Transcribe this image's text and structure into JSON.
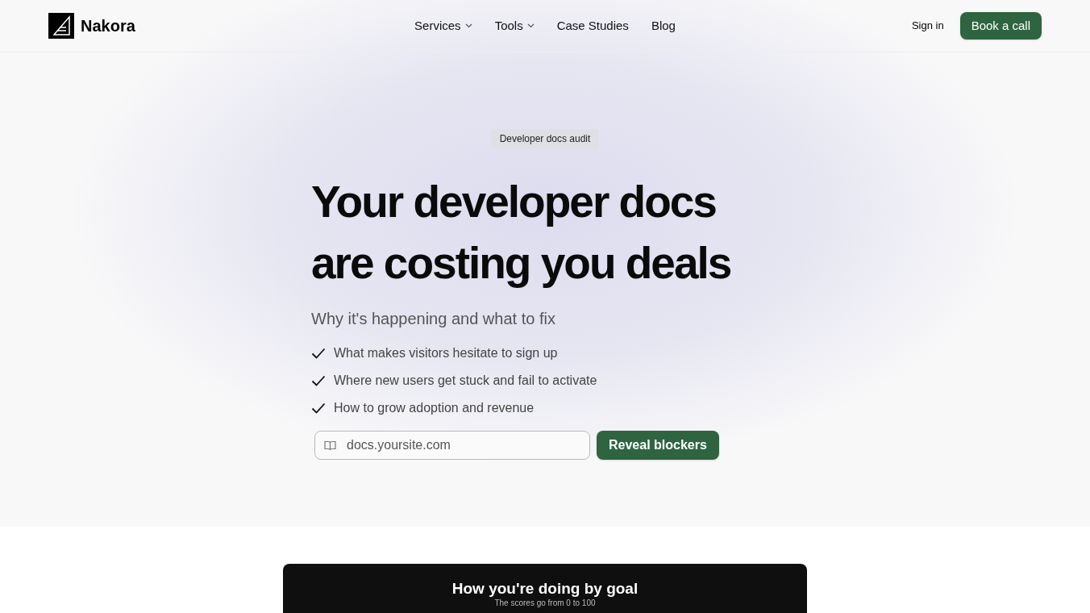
{
  "brand": {
    "name": "Nakora"
  },
  "nav": [
    {
      "label": "Services",
      "has_menu": true
    },
    {
      "label": "Tools",
      "has_menu": true
    },
    {
      "label": "Case Studies",
      "has_menu": false
    },
    {
      "label": "Blog",
      "has_menu": false
    }
  ],
  "actions": {
    "sign_in": "Sign in",
    "cta": "Book a call"
  },
  "hero": {
    "badge": "Developer docs audit",
    "title_lines": [
      "Your developer docs",
      "are costing you deals"
    ],
    "subtitle": "Why it's happening and what to fix",
    "checklist": [
      "What makes visitors hesitate to sign up",
      "Where new users get stuck and fail to activate",
      "How to grow adoption and revenue"
    ],
    "input": {
      "placeholder": "docs.yoursite.com"
    },
    "button": "Reveal blockers"
  },
  "score_card": {
    "title": "How you're doing by goal",
    "subtitle": "The scores go from 0 to 100"
  }
}
